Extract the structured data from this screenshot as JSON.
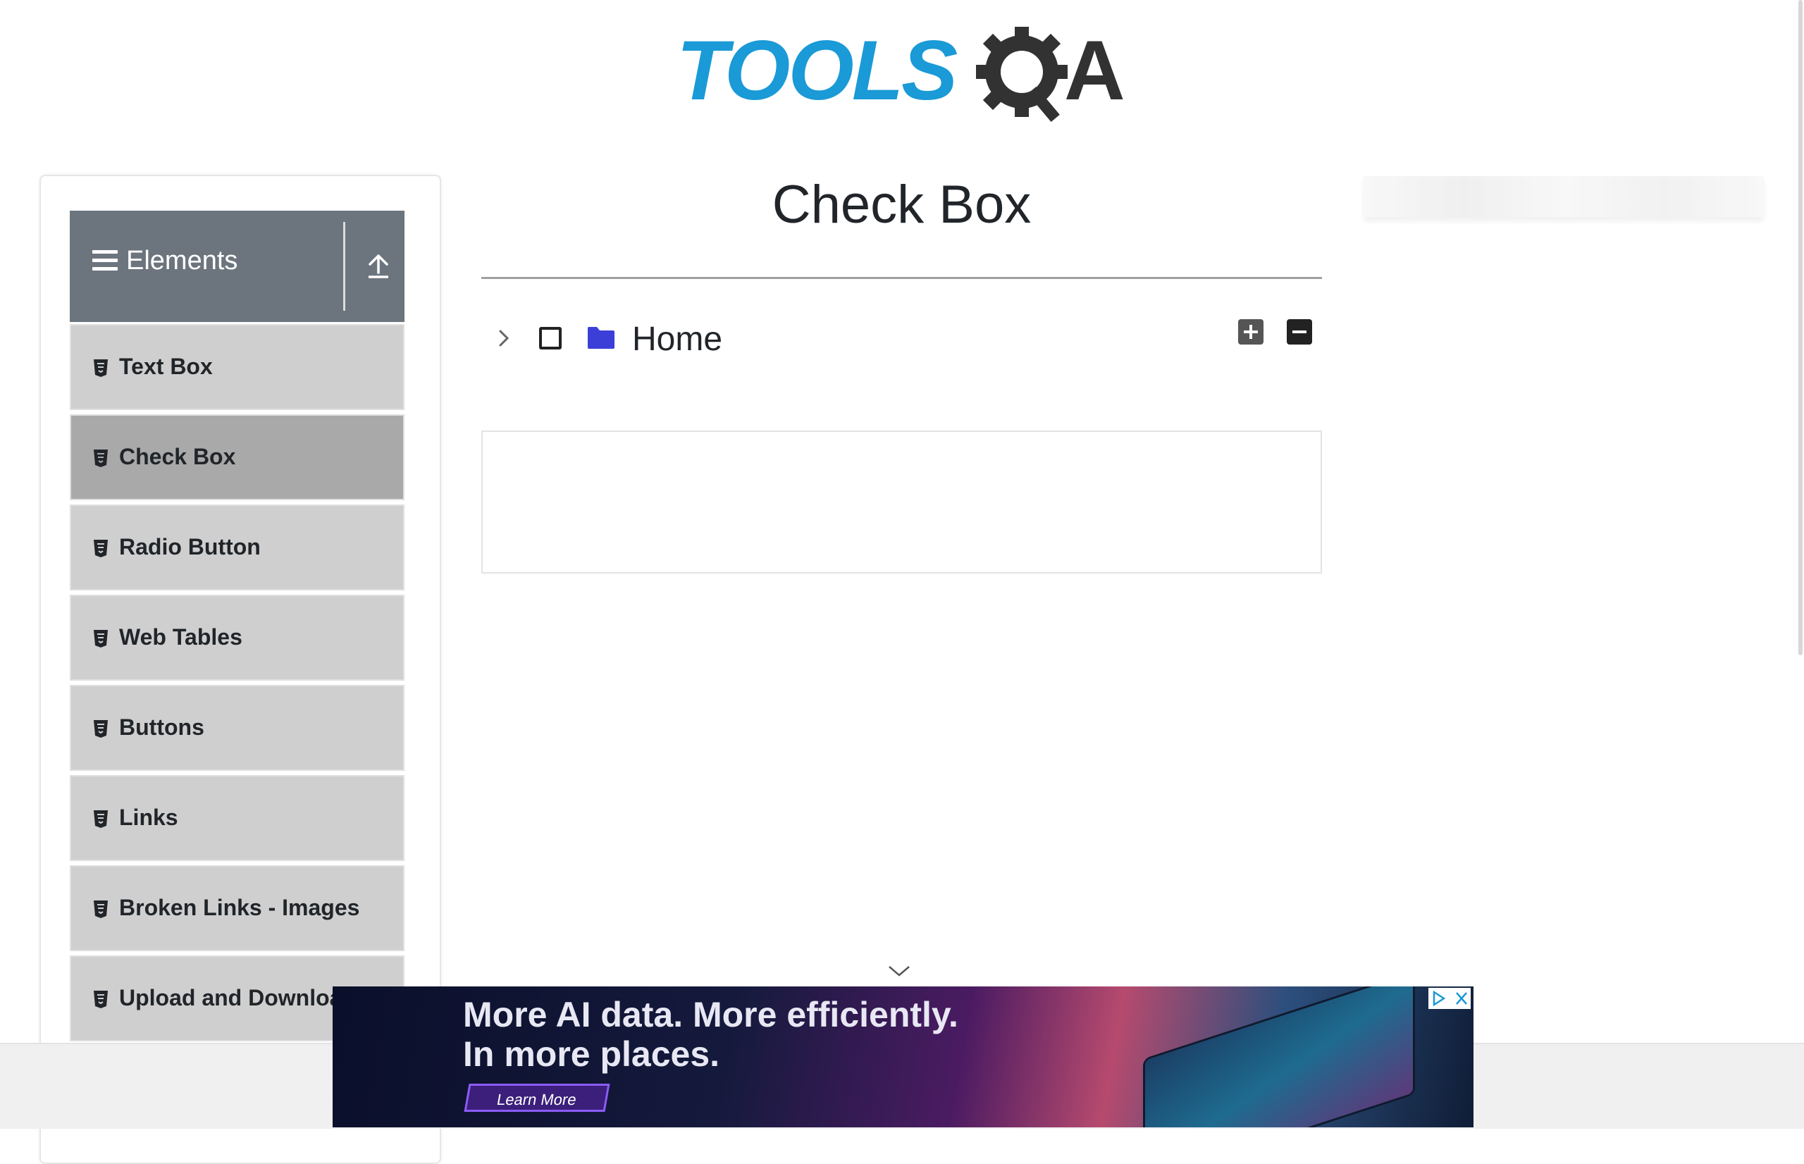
{
  "header": {
    "logo_text_primary": "TOOLS",
    "logo_text_secondary": "A",
    "logo_icon": "gear-magnifier-icon",
    "colors": {
      "tools_blue": "#1a9ad6",
      "qa_dark": "#323232"
    }
  },
  "sidebar": {
    "group_title": "Elements",
    "group_icon": "hamburger-icon",
    "collapse_icon": "upload-arrow-icon",
    "items": [
      {
        "label": "Text Box",
        "icon": "html5-icon",
        "active": false
      },
      {
        "label": "Check Box",
        "icon": "html5-icon",
        "active": true
      },
      {
        "label": "Radio Button",
        "icon": "html5-icon",
        "active": false
      },
      {
        "label": "Web Tables",
        "icon": "html5-icon",
        "active": false
      },
      {
        "label": "Buttons",
        "icon": "html5-icon",
        "active": false
      },
      {
        "label": "Links",
        "icon": "html5-icon",
        "active": false
      },
      {
        "label": "Broken Links - Images",
        "icon": "html5-icon",
        "active": false
      },
      {
        "label": "Upload and Download",
        "icon": "html5-icon",
        "active": false
      }
    ],
    "colors": {
      "header_bg": "#6c757d",
      "item_bg": "#cfcfcf",
      "active_bg": "#a9a9a9"
    }
  },
  "main": {
    "title": "Check Box",
    "tree": {
      "root_label": "Home",
      "checked": false,
      "expanded": false,
      "folder_color": "#3b3fd8"
    },
    "expand_all_icon": "plus-square-icon",
    "collapse_all_icon": "minus-square-icon"
  },
  "ad_banner": {
    "headline": "More AI data. More efficiently.\nIn more places.",
    "cta": "Learn More",
    "icon": "ad-choices-icon"
  }
}
